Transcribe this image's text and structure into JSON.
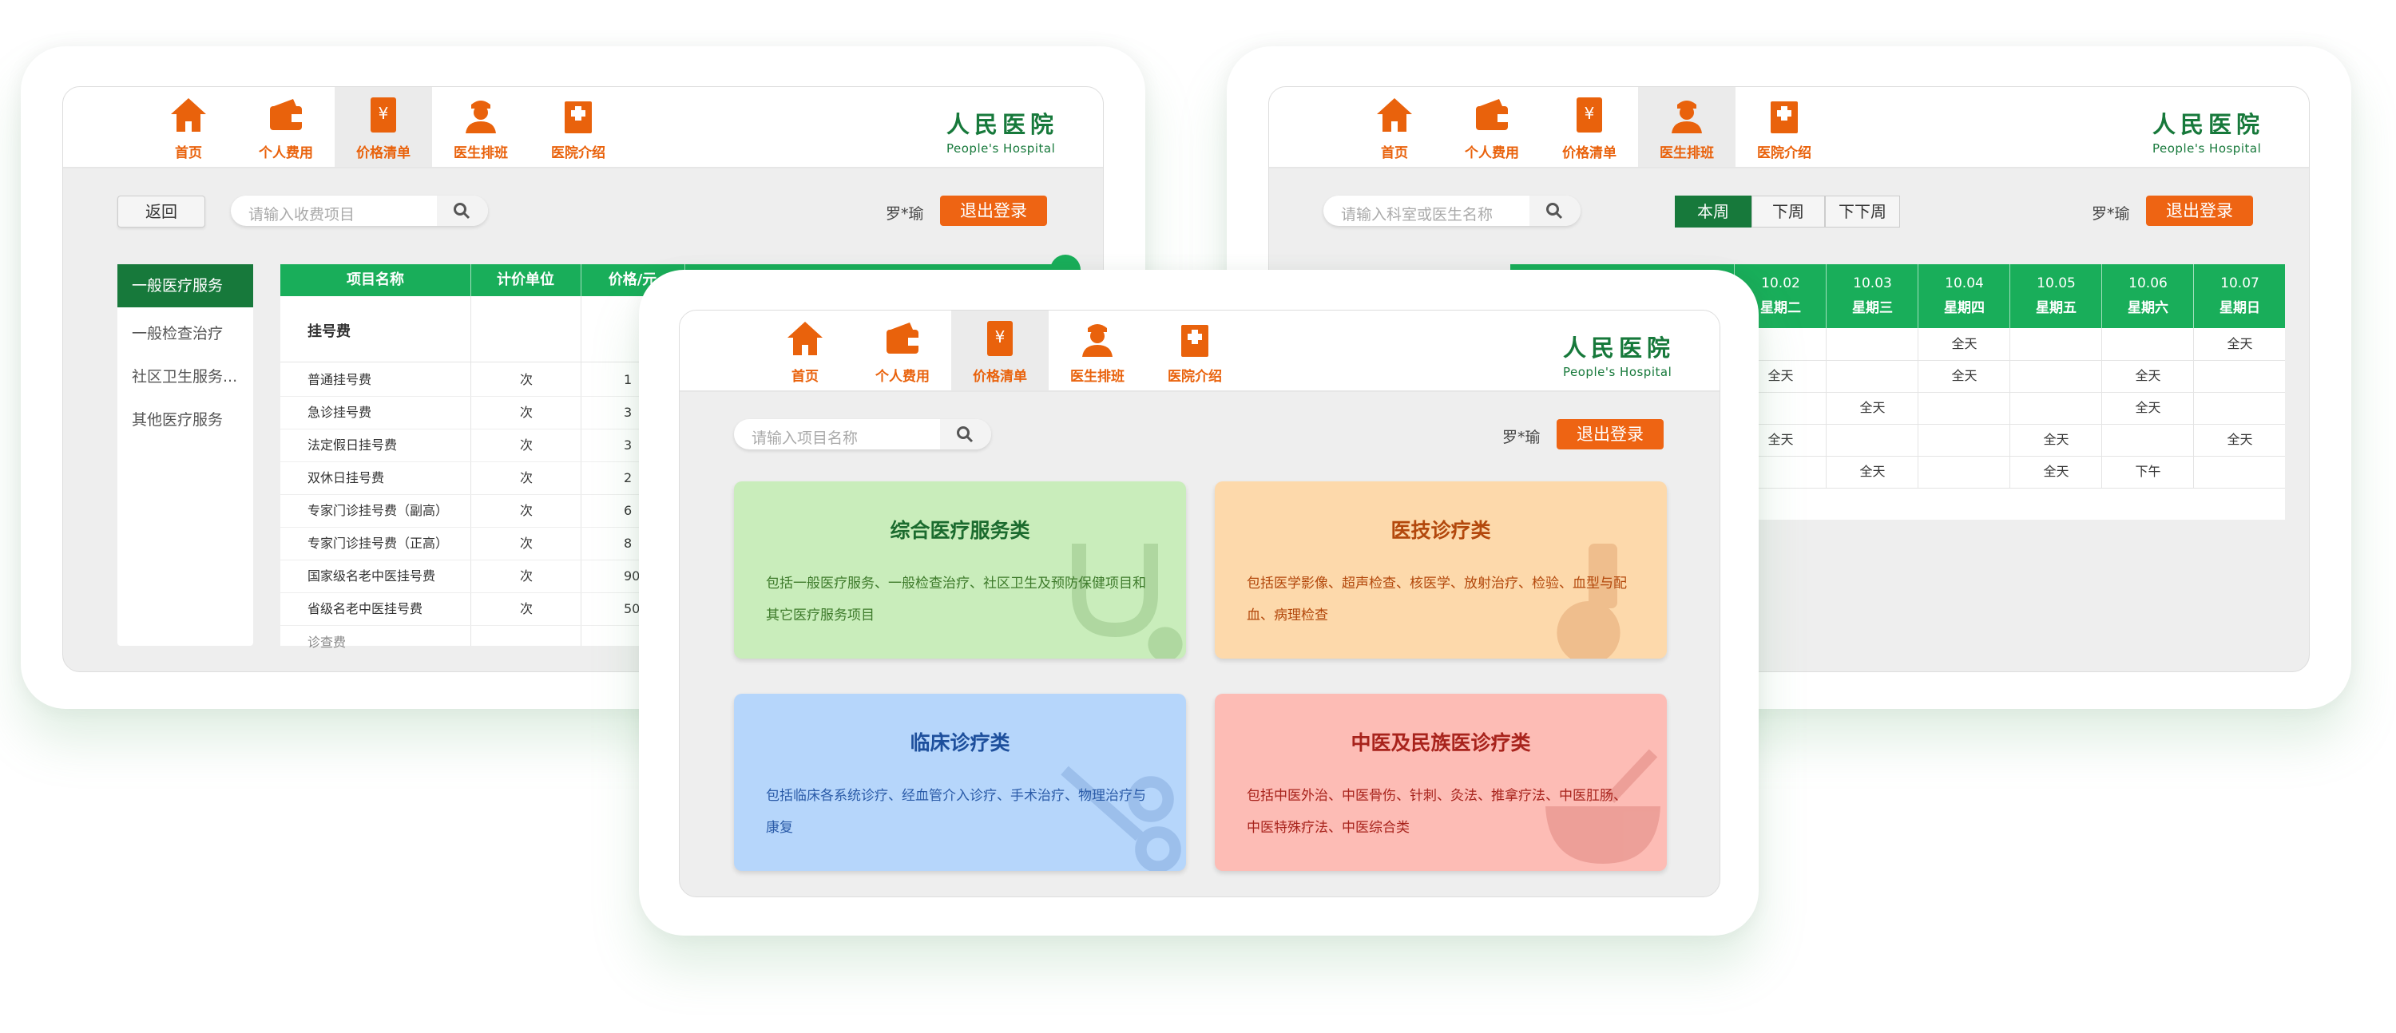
{
  "nav": {
    "items": [
      {
        "label": "首页",
        "icon": "home-icon"
      },
      {
        "label": "个人费用",
        "icon": "wallet-icon"
      },
      {
        "label": "价格清单",
        "icon": "price-list-icon"
      },
      {
        "label": "医生排班",
        "icon": "doctor-icon"
      },
      {
        "label": "医院介绍",
        "icon": "hospital-icon"
      }
    ]
  },
  "logo": {
    "cn": "人民医院",
    "en": "People's Hospital"
  },
  "user": {
    "name": "罗*瑜",
    "logout": "退出登录"
  },
  "colors": {
    "accent": "#ee6413",
    "brand": "#17793b",
    "table_header": "#19ae5a"
  },
  "left": {
    "back": "返回",
    "search_placeholder": "请输入收费项目",
    "sidebar": [
      "一般医疗服务",
      "一般检查治疗",
      "社区卫生服务...",
      "其他医疗服务"
    ],
    "table_headers": [
      "项目名称",
      "计价单位",
      "价格/元"
    ],
    "group": "挂号费",
    "rows": [
      {
        "name": "普通挂号费",
        "unit": "次",
        "price": "1"
      },
      {
        "name": "急诊挂号费",
        "unit": "次",
        "price": "3"
      },
      {
        "name": "法定假日挂号费",
        "unit": "次",
        "price": "3"
      },
      {
        "name": "双休日挂号费",
        "unit": "次",
        "price": "2"
      },
      {
        "name": "专家门诊挂号费（副高）",
        "unit": "次",
        "price": "6"
      },
      {
        "name": "专家门诊挂号费（正高）",
        "unit": "次",
        "price": "8"
      },
      {
        "name": "国家级名老中医挂号费",
        "unit": "次",
        "price": "90"
      },
      {
        "name": "省级名老中医挂号费",
        "unit": "次",
        "price": "50"
      }
    ],
    "next_group": "诊查费"
  },
  "right": {
    "search_placeholder": "请输入科室或医生名称",
    "weeks": [
      "本周",
      "下周",
      "下下周"
    ],
    "days": [
      {
        "date": "10.02",
        "week": "星期二"
      },
      {
        "date": "10.03",
        "week": "星期三"
      },
      {
        "date": "10.04",
        "week": "星期四"
      },
      {
        "date": "10.05",
        "week": "星期五"
      },
      {
        "date": "10.06",
        "week": "星期六"
      },
      {
        "date": "10.07",
        "week": "星期日"
      }
    ],
    "rows": [
      [
        "",
        "",
        "全天",
        "",
        "",
        "全天"
      ],
      [
        "全天",
        "",
        "全天",
        "",
        "全天",
        ""
      ],
      [
        "",
        "全天",
        "",
        "",
        "全天",
        ""
      ],
      [
        "全天",
        "",
        "",
        "全天",
        "",
        "全天"
      ],
      [
        "",
        "全天",
        "",
        "全天",
        "下午",
        ""
      ]
    ]
  },
  "center": {
    "search_placeholder": "请输入项目名称",
    "cards": [
      {
        "title": "综合医疗服务类",
        "desc": "包括一般医疗服务、一般检查治疗、社区卫生及预防保健项目和其它医疗服务项目",
        "bg": "#c9edbb",
        "title_color": "#1b6b2e",
        "desc_color": "#3d7a2a"
      },
      {
        "title": "医技诊疗类",
        "desc": "包括医学影像、超声检查、核医学、放射治疗、检验、血型与配血、病理检查",
        "bg": "#fdd9ab",
        "title_color": "#b3480c",
        "desc_color": "#b3480c"
      },
      {
        "title": "临床诊疗类",
        "desc": "包括临床各系统诊疗、经血管介入诊疗、手术治疗、物理治疗与康复",
        "bg": "#b6d6fb",
        "title_color": "#1d4f9c",
        "desc_color": "#2a5ba8"
      },
      {
        "title": "中医及民族医诊疗类",
        "desc": "包括中医外治、中医骨伤、针刺、灸法、推拿疗法、中医肛肠、中医特殊疗法、中医综合类",
        "bg": "#fdbcb5",
        "title_color": "#a8231c",
        "desc_color": "#a8231c"
      }
    ]
  }
}
